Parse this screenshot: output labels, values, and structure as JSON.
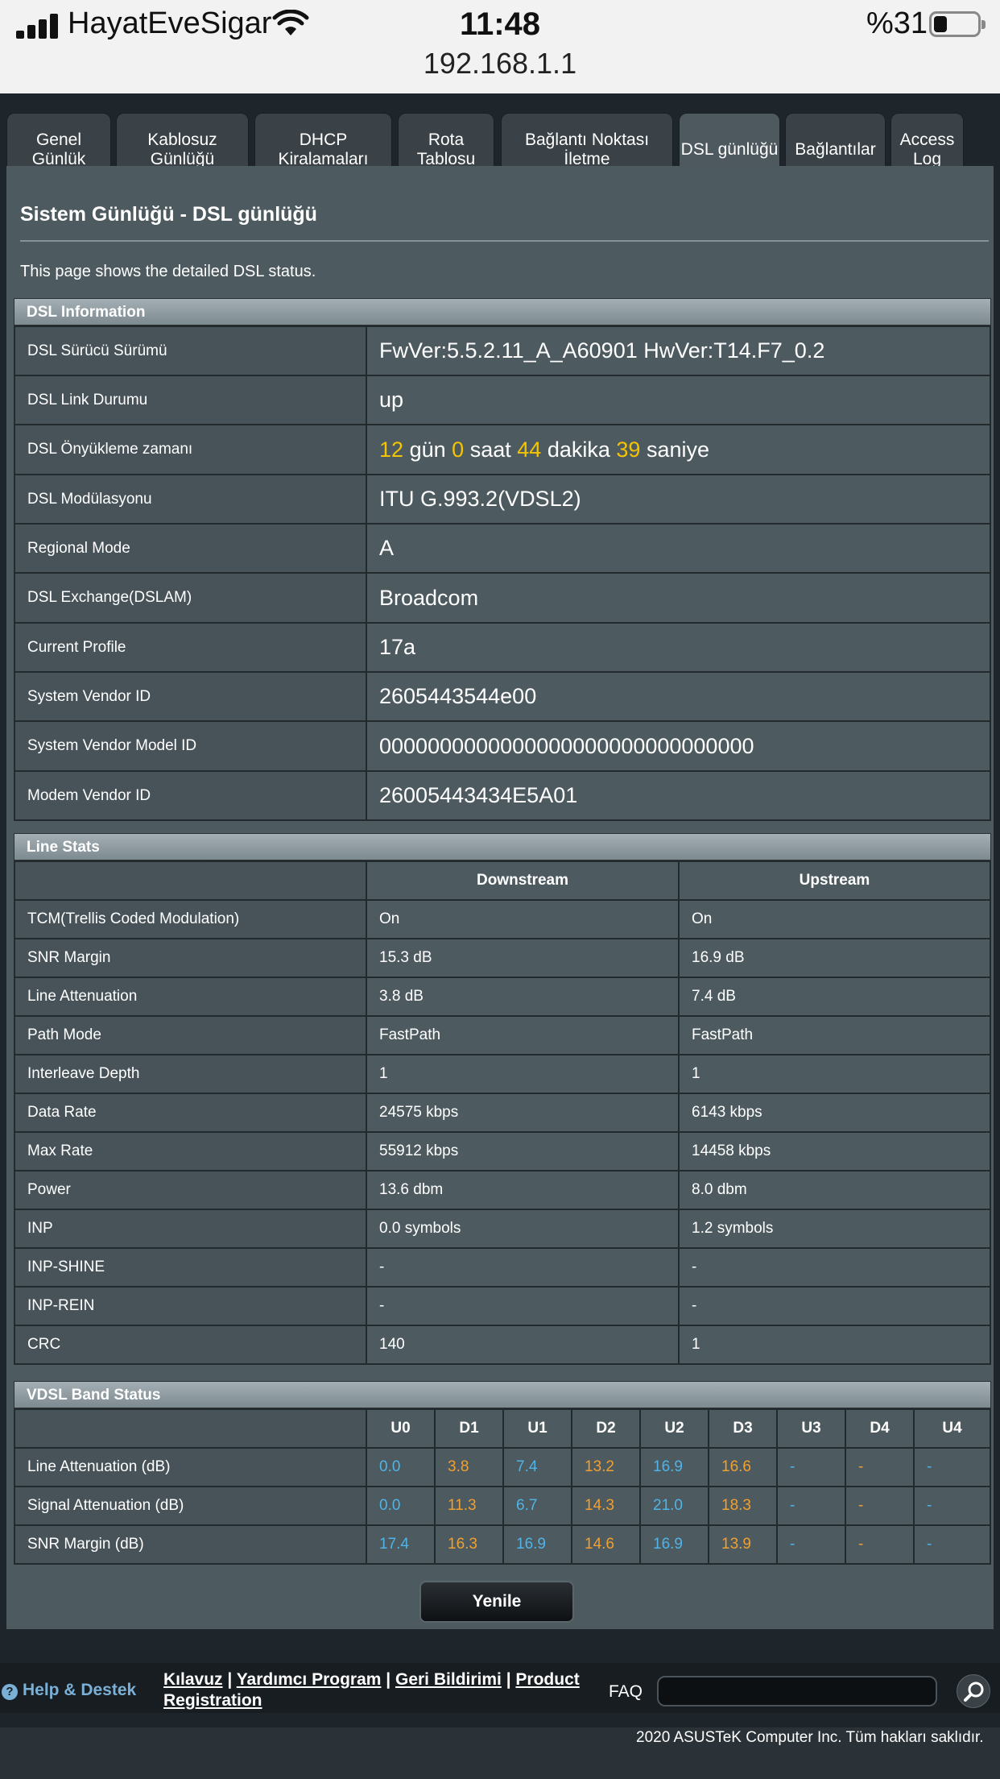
{
  "status_bar": {
    "carrier": "HayatEveSigar",
    "time": "11:48",
    "battery_percent": "%31",
    "url": "192.168.1.1"
  },
  "tabs": [
    {
      "label": "Genel Günlük"
    },
    {
      "label": "Kablosuz Günlüğü"
    },
    {
      "label": "DHCP Kiralamaları"
    },
    {
      "label": "Rota Tablosu"
    },
    {
      "label": "Bağlantı Noktası İletme"
    },
    {
      "label": "DSL günlüğü",
      "active": true
    },
    {
      "label": "Bağlantılar"
    },
    {
      "label": "Access Log"
    }
  ],
  "panel": {
    "title": "Sistem Günlüğü - DSL günlüğü",
    "description": "This page shows the detailed DSL status."
  },
  "dsl_info": {
    "heading": "DSL Information",
    "rows": [
      {
        "label": "DSL Sürücü Sürümü",
        "value": "FwVer:5.5.2.11_A_A60901 HwVer:T14.F7_0.2"
      },
      {
        "label": "DSL Link Durumu",
        "value": "up"
      },
      {
        "label": "DSL Önyükleme zamanı",
        "value": ""
      },
      {
        "label": "DSL Modülasyonu",
        "value": "ITU G.993.2(VDSL2)"
      },
      {
        "label": "Regional Mode",
        "value": "A"
      },
      {
        "label": "DSL Exchange(DSLAM)",
        "value": "Broadcom"
      },
      {
        "label": "Current Profile",
        "value": "17a"
      },
      {
        "label": "System Vendor ID",
        "value": "2605443544e00"
      },
      {
        "label": "System Vendor Model ID",
        "value": "0000000000000000000000000000000"
      },
      {
        "label": "Modem Vendor ID",
        "value": "26005443434E5A01"
      }
    ],
    "uptime": {
      "days": "12",
      "days_unit": "gün",
      "hours": "0",
      "hours_unit": "saat",
      "minutes": "44",
      "minutes_unit": "dakika",
      "seconds": "39",
      "seconds_unit": "saniye"
    }
  },
  "line_stats": {
    "heading": "Line Stats",
    "col_down": "Downstream",
    "col_up": "Upstream",
    "rows": [
      {
        "label": "TCM(Trellis Coded Modulation)",
        "down": "On",
        "up": "On"
      },
      {
        "label": "SNR Margin",
        "down": "15.3 dB",
        "up": "16.9 dB"
      },
      {
        "label": "Line Attenuation",
        "down": "3.8 dB",
        "up": "7.4 dB"
      },
      {
        "label": "Path Mode",
        "down": "FastPath",
        "up": "FastPath"
      },
      {
        "label": "Interleave Depth",
        "down": "1",
        "up": "1"
      },
      {
        "label": "Data Rate",
        "down": "24575 kbps",
        "up": "6143 kbps"
      },
      {
        "label": "Max Rate",
        "down": "55912 kbps",
        "up": "14458 kbps"
      },
      {
        "label": "Power",
        "down": "13.6 dbm",
        "up": "8.0 dbm"
      },
      {
        "label": "INP",
        "down": "0.0 symbols",
        "up": "1.2 symbols"
      },
      {
        "label": "INP-SHINE",
        "down": "-",
        "up": "-"
      },
      {
        "label": "INP-REIN",
        "down": "-",
        "up": "-"
      },
      {
        "label": "CRC",
        "down": "140",
        "up": "1"
      }
    ]
  },
  "vdsl_band": {
    "heading": "VDSL Band Status",
    "bands": [
      "U0",
      "D1",
      "U1",
      "D2",
      "U2",
      "D3",
      "U3",
      "D4",
      "U4"
    ],
    "rows": [
      {
        "label": "Line Attenuation (dB)",
        "values": [
          "0.0",
          "3.8",
          "7.4",
          "13.2",
          "16.9",
          "16.6",
          "-",
          "-",
          "-"
        ]
      },
      {
        "label": "Signal Attenuation (dB)",
        "values": [
          "0.0",
          "11.3",
          "6.7",
          "14.3",
          "21.0",
          "18.3",
          "-",
          "-",
          "-"
        ]
      },
      {
        "label": "SNR Margin (dB)",
        "values": [
          "17.4",
          "16.3",
          "16.9",
          "14.6",
          "16.9",
          "13.9",
          "-",
          "-",
          "-"
        ]
      }
    ]
  },
  "refresh_label": "Yenile",
  "footer": {
    "help": "Help & Destek",
    "links": [
      "Kılavuz",
      "Yardımcı Program",
      "Geri Bildirimi",
      "Product Registration"
    ],
    "faq": "FAQ",
    "copyright": "2020 ASUSTeK Computer Inc. Tüm hakları saklıdır."
  },
  "colors": {
    "upstream_band": "#4fb4e6",
    "downstream_band": "#f0a030",
    "uptime_number": "#f5c400"
  },
  "icons": {
    "signal": "cellular-signal-icon",
    "wifi": "wifi-icon",
    "battery": "battery-icon",
    "help": "help-icon",
    "search": "search-icon"
  }
}
